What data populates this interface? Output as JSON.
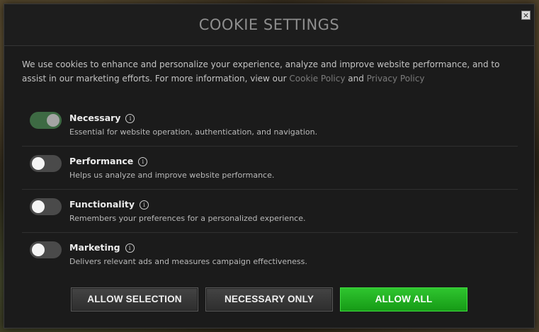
{
  "dialog": {
    "title": "COOKIE SETTINGS",
    "close_glyph": "×"
  },
  "intro": {
    "text_before": "We use cookies to enhance and personalize your experience, analyze and improve website performance, and to assist in our marketing efforts. For more information, view our ",
    "cookie_policy_label": "Cookie Policy",
    "joiner": " and ",
    "privacy_policy_label": "Privacy Policy"
  },
  "options": [
    {
      "title": "Necessary",
      "description": "Essential for website operation, authentication, and navigation.",
      "enabled": true
    },
    {
      "title": "Performance",
      "description": "Helps us analyze and improve website performance.",
      "enabled": false
    },
    {
      "title": "Functionality",
      "description": "Remembers your preferences for a personalized experience.",
      "enabled": false
    },
    {
      "title": "Marketing",
      "description": "Delivers relevant ads and measures campaign effectiveness.",
      "enabled": false
    }
  ],
  "info_glyph": "i",
  "buttons": {
    "allow_selection": "ALLOW SELECTION",
    "necessary_only": "NECESSARY ONLY",
    "allow_all": "ALLOW ALL"
  },
  "colors": {
    "accent_green": "#21b021",
    "toggle_on": "#3d6a43",
    "toggle_off": "#4a4a4a"
  }
}
